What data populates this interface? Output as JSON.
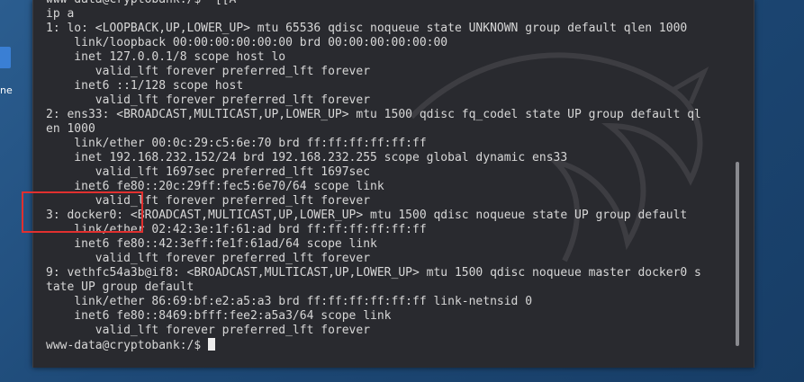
{
  "desktop": {
    "label_fragment": "ne"
  },
  "terminal": {
    "prompt": "www-data@cryptobank:/$ ",
    "lines": [
      "www-data@cryptobank:/$ ^[[A",
      "ip a",
      "1: lo: <LOOPBACK,UP,LOWER_UP> mtu 65536 qdisc noqueue state UNKNOWN group default qlen 1000",
      "    link/loopback 00:00:00:00:00:00 brd 00:00:00:00:00:00",
      "    inet 127.0.0.1/8 scope host lo",
      "       valid_lft forever preferred_lft forever",
      "    inet6 ::1/128 scope host",
      "       valid_lft forever preferred_lft forever",
      "2: ens33: <BROADCAST,MULTICAST,UP,LOWER_UP> mtu 1500 qdisc fq_codel state UP group default ql",
      "en 1000",
      "    link/ether 00:0c:29:c5:6e:70 brd ff:ff:ff:ff:ff:ff",
      "    inet 192.168.232.152/24 brd 192.168.232.255 scope global dynamic ens33",
      "       valid_lft 1697sec preferred_lft 1697sec",
      "    inet6 fe80::20c:29ff:fec5:6e70/64 scope link",
      "       valid_lft forever preferred_lft forever",
      "3: docker0: <BROADCAST,MULTICAST,UP,LOWER_UP> mtu 1500 qdisc noqueue state UP group default",
      "    link/ether 02:42:3e:1f:61:ad brd ff:ff:ff:ff:ff:ff",
      "    inet6 fe80::42:3eff:fe1f:61ad/64 scope link",
      "       valid_lft forever preferred_lft forever",
      "9: vethfc54a3b@if8: <BROADCAST,MULTICAST,UP,LOWER_UP> mtu 1500 qdisc noqueue master docker0 s",
      "tate UP group default",
      "    link/ether 86:69:bf:e2:a5:a3 brd ff:ff:ff:ff:ff:ff link-netnsid 0",
      "    inet6 fe80::8469:bfff:fee2:a5a3/64 scope link",
      "       valid_lft forever preferred_lft forever"
    ]
  },
  "colors": {
    "terminal_bg": "#292a2f",
    "terminal_text": "#d7d7d7",
    "annotation": "#e1302f",
    "desktop_bg": "#1e4a78"
  }
}
